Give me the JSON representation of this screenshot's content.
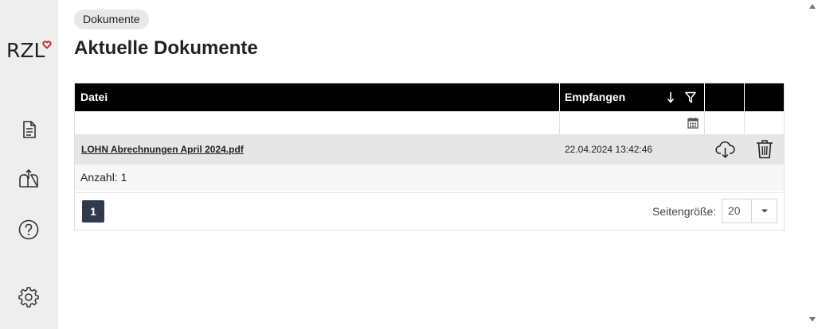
{
  "brand": {
    "logo_text": "RZL"
  },
  "sidebar": {
    "items": [
      {
        "name": "documents",
        "icon": "document-icon"
      },
      {
        "name": "upload",
        "icon": "mailbox-upload-icon"
      },
      {
        "name": "help",
        "icon": "help-icon"
      },
      {
        "name": "settings",
        "icon": "gear-icon"
      }
    ]
  },
  "breadcrumb": {
    "label": "Dokumente"
  },
  "page": {
    "title": "Aktuelle Dokumente"
  },
  "table": {
    "columns": {
      "file": "Datei",
      "received": "Empfangen"
    },
    "rows": [
      {
        "file": "LOHN Abrechnungen April 2024.pdf",
        "received": "22.04.2024 13:42:46"
      }
    ],
    "count_label": "Anzahl: 1"
  },
  "pager": {
    "current_page": "1",
    "page_size_label": "Seitengröße:",
    "page_size": "20"
  },
  "colors": {
    "header_bg": "#000000",
    "accent_red": "#c8202f",
    "page_button": "#2f3a4b"
  }
}
